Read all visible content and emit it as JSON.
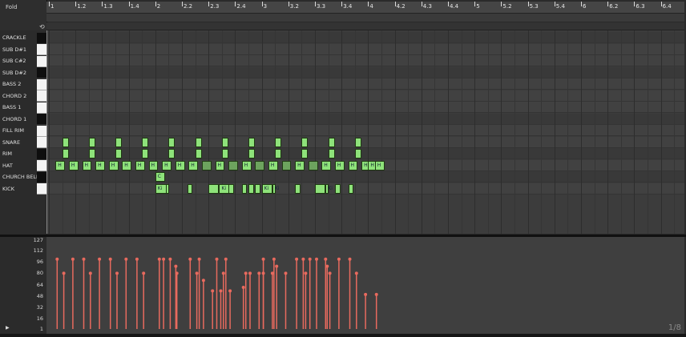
{
  "header": {
    "fold_label": "Fold",
    "loop_icon": "loop-icon"
  },
  "ruler": {
    "labels": [
      "1",
      "1.2",
      "1.3",
      "1.4",
      "2",
      "2.2",
      "2.3",
      "2.4",
      "3",
      "3.2",
      "3.3",
      "3.4",
      "4",
      "4.2",
      "4.3",
      "4.4",
      "5",
      "5.2",
      "5.3",
      "5.4",
      "6",
      "6.2",
      "6.3",
      "6.4"
    ]
  },
  "lanes": [
    {
      "name": "CRACKLE",
      "key": "black"
    },
    {
      "name": "SUB D#1",
      "key": "white"
    },
    {
      "name": "SUB C#2",
      "key": "white"
    },
    {
      "name": "SUB D#2",
      "key": "black"
    },
    {
      "name": "BASS 2",
      "key": "white"
    },
    {
      "name": "CHORD 2",
      "key": "white"
    },
    {
      "name": "BASS 1",
      "key": "white"
    },
    {
      "name": "CHORD 1",
      "key": "black"
    },
    {
      "name": "FILL RIM",
      "key": "white"
    },
    {
      "name": "SNARE",
      "key": "white"
    },
    {
      "name": "RIM",
      "key": "black"
    },
    {
      "name": "HAT",
      "key": "white"
    },
    {
      "name": "CHURCH BELL",
      "key": "black"
    },
    {
      "name": "KICK",
      "key": "white"
    }
  ],
  "notes": {
    "snare": {
      "lane": 9,
      "starts": [
        0.5,
        1.5,
        2.5,
        3.5,
        4.5,
        5.5,
        6.5,
        7.5,
        8.5,
        9.5,
        10.5,
        11.5
      ],
      "label": ""
    },
    "rim": {
      "lane": 10,
      "starts": [
        0.5,
        1.5,
        2.5,
        3.5,
        4.5,
        5.5,
        6.5,
        7.5,
        8.5,
        9.5,
        10.5,
        11.5
      ],
      "label": ""
    },
    "hat": {
      "lane": 11,
      "starts": [
        0.25,
        0.75,
        1.25,
        1.75,
        2.25,
        2.75,
        3.25,
        3.75,
        4.25,
        4.75,
        5.25,
        5.75,
        6.25,
        6.75,
        7.25,
        7.75,
        8.25,
        8.75,
        9.25,
        9.75,
        10.25,
        10.75,
        11.25,
        11.75,
        12.0,
        12.25
      ],
      "label": "H",
      "dim_idx": [
        11,
        13,
        15,
        17,
        19
      ]
    },
    "bell": {
      "lane": 12,
      "starts": [
        4.0
      ],
      "label": "C"
    },
    "kick": {
      "lane": 13,
      "starts": [
        4.0,
        4.4,
        5.2,
        6.0,
        6.4,
        6.75,
        7.25,
        7.5,
        7.75,
        8.0,
        8.4,
        9.25,
        10.0,
        10.4,
        10.75,
        11.25
      ],
      "label": "Ki",
      "labeled_idx": [
        0,
        4,
        9,
        10,
        13
      ],
      "widths": [
        0.22,
        0.04,
        0.1,
        0.2,
        0.2,
        0.1,
        0.1,
        0.1,
        0.1,
        0.2,
        0.04,
        0.1,
        0.2,
        0.04,
        0.1,
        0.1
      ]
    }
  },
  "velocity": {
    "ticks": [
      "127",
      "112",
      "96",
      "80",
      "64",
      "48",
      "32",
      "16",
      "1"
    ],
    "values": [
      100,
      80,
      100,
      100,
      80,
      100,
      100,
      80,
      100,
      100,
      80,
      100,
      100,
      100,
      90,
      80,
      100,
      100,
      80,
      70,
      55,
      100,
      55,
      100,
      80,
      55,
      80,
      60,
      80,
      80,
      80,
      100,
      80,
      100,
      90,
      80,
      100,
      100,
      80,
      100,
      100,
      100,
      90,
      80,
      100,
      100,
      80,
      50,
      50
    ],
    "beats": [
      0.25,
      0.5,
      0.75,
      1.25,
      1.5,
      1.75,
      2.25,
      2.5,
      2.75,
      3.25,
      3.5,
      4.0,
      4.25,
      4.5,
      4.62,
      4.75,
      5.25,
      5.5,
      5.5,
      5.75,
      6.0,
      6.25,
      6.4,
      6.5,
      6.5,
      6.75,
      7.25,
      7.25,
      7.5,
      7.75,
      8.0,
      8.0,
      8.25,
      8.4,
      8.5,
      8.75,
      9.25,
      9.5,
      9.5,
      9.75,
      10.0,
      10.25,
      10.4,
      10.5,
      10.75,
      11.25,
      11.5,
      11.75,
      12.25
    ]
  },
  "footer": {
    "zoom": "1/8"
  }
}
